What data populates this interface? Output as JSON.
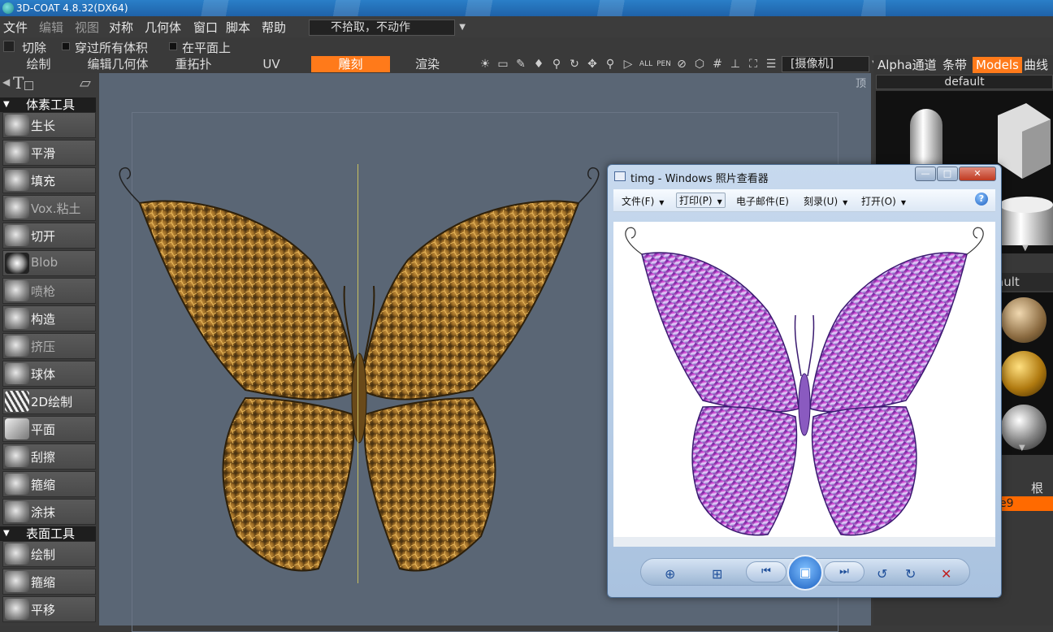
{
  "window": {
    "title": "3D-COAT 4.8.32(DX64)"
  },
  "menu": {
    "items": [
      {
        "label": "文件",
        "dim": false
      },
      {
        "label": "编辑",
        "dim": true
      },
      {
        "label": "视图",
        "dim": true
      },
      {
        "label": "对称",
        "dim": false
      },
      {
        "label": "几何体",
        "dim": false
      },
      {
        "label": "窗口",
        "dim": false
      },
      {
        "label": "脚本",
        "dim": false
      },
      {
        "label": "帮助",
        "dim": false
      }
    ],
    "mode_select": "不拾取，不动作"
  },
  "options": {
    "cut": "切除",
    "through_all": "穿过所有体积",
    "on_plane": "在平面上"
  },
  "rooms": {
    "tabs": [
      "绘制",
      "编辑几何体",
      "重拓扑",
      "UV",
      "雕刻",
      "渲染"
    ],
    "active": "雕刻",
    "camera": "[摄像机]"
  },
  "toolbar_icons": [
    "light-icon",
    "image-icon",
    "wand-icon",
    "drop-icon",
    "compass-icon",
    "rotate-icon",
    "move-icon",
    "zoom-icon",
    "play-icon",
    "all-icon",
    "pen-icon",
    "forbid-icon",
    "cube-icon",
    "grid-icon",
    "axis-icon",
    "fit-icon",
    "panels-icon"
  ],
  "left_panel": {
    "voxel_header": "体素工具",
    "voxel_tools": [
      {
        "label": "生长",
        "dim": false
      },
      {
        "label": "平滑",
        "dim": false
      },
      {
        "label": "填充",
        "dim": false
      },
      {
        "label": "Vox.粘土",
        "dim": true
      },
      {
        "label": "切开",
        "dim": false
      },
      {
        "label": "Blob",
        "dim": true
      },
      {
        "label": "喷枪",
        "dim": true
      },
      {
        "label": "构造",
        "dim": false
      },
      {
        "label": "挤压",
        "dim": true
      },
      {
        "label": "球体",
        "dim": false
      },
      {
        "label": "2D绘制",
        "dim": false
      },
      {
        "label": "平面",
        "dim": false
      },
      {
        "label": "刮擦",
        "dim": false
      },
      {
        "label": "箍缩",
        "dim": false
      },
      {
        "label": "涂抹",
        "dim": false
      }
    ],
    "surface_header": "表面工具",
    "surface_tools": [
      {
        "label": "绘制",
        "dim": false
      },
      {
        "label": "箍缩",
        "dim": false
      },
      {
        "label": "平移",
        "dim": false
      }
    ]
  },
  "viewport": {
    "view_label": "顶"
  },
  "right_panel": {
    "tabs": [
      "Alpha通道",
      "条带",
      "Models",
      "曲线"
    ],
    "active_tab": "Models",
    "preset": "default",
    "sub_header": "ault",
    "root_label": "根",
    "selected_item": "e9"
  },
  "photo_viewer": {
    "title": "timg - Windows 照片查看器",
    "menu": [
      "文件(F)",
      "打印(P)",
      "电子邮件(E)",
      "刻录(U)",
      "打开(O)"
    ],
    "menu_dropdowns": [
      true,
      true,
      false,
      true,
      true
    ],
    "help": "?",
    "buttons": {
      "minimize": "—",
      "maximize": "□",
      "close": "✕"
    }
  },
  "colors": {
    "accent": "#ff7a1a",
    "viewport_bg": "#5a6675",
    "panel_bg": "#3b3b3b"
  }
}
